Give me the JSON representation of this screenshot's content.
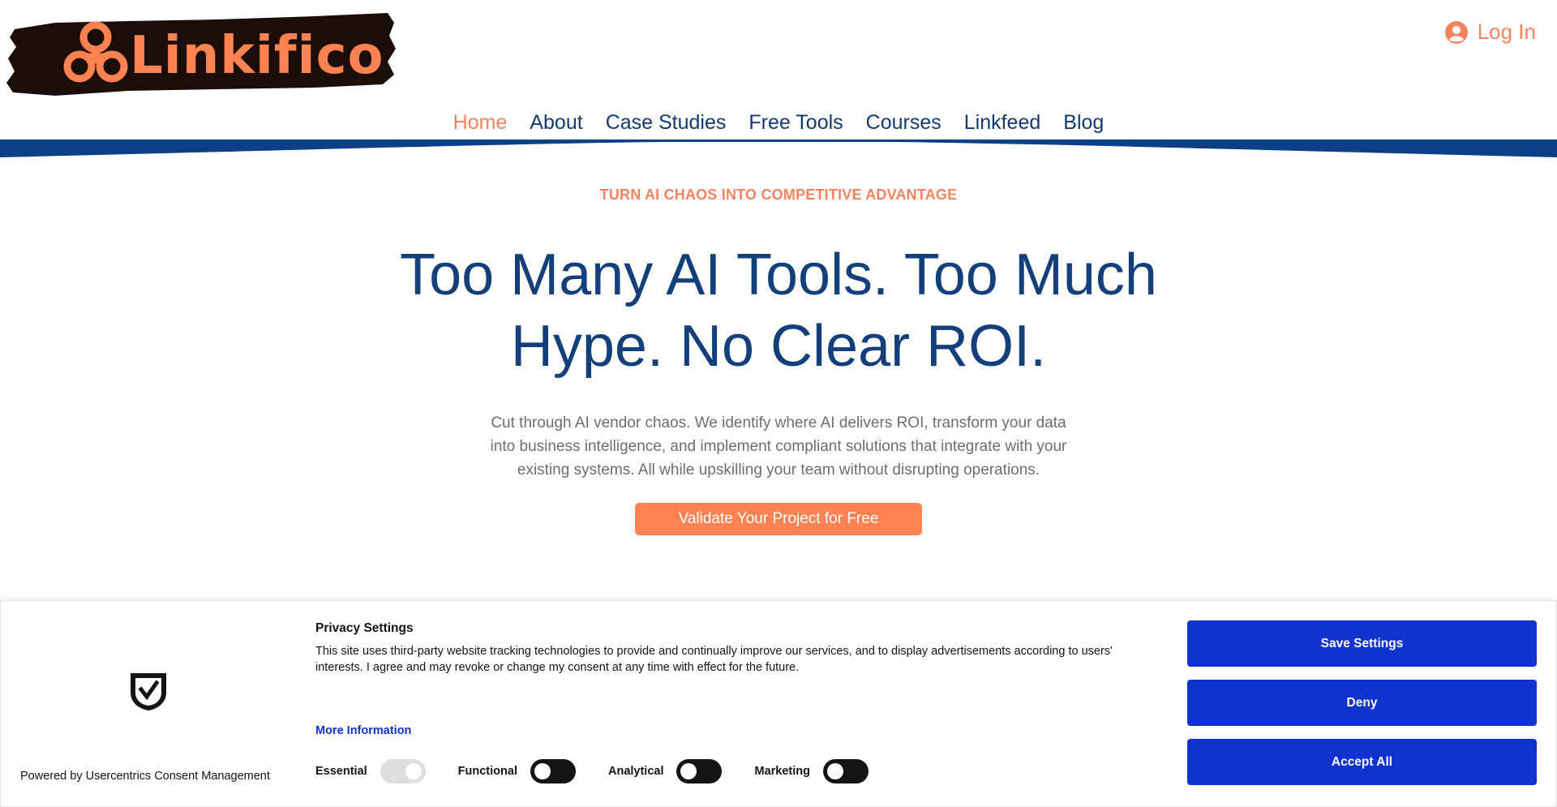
{
  "header": {
    "logo_text": "Linkifico",
    "login_label": "Log In",
    "nav": [
      {
        "label": "Home",
        "active": true
      },
      {
        "label": "About"
      },
      {
        "label": "Case Studies"
      },
      {
        "label": "Free Tools"
      },
      {
        "label": "Courses"
      },
      {
        "label": "Linkfeed"
      },
      {
        "label": "Blog"
      }
    ]
  },
  "hero": {
    "eyebrow": "TURN AI CHAOS INTO COMPETITIVE ADVANTAGE",
    "headline": "Too Many AI Tools. Too Much Hype. No Clear ROI.",
    "subtext": "Cut through AI vendor chaos. We identify where AI delivers ROI, transform your data into business intelligence, and implement compliant solutions that integrate with your existing systems. All while upskilling your team without disrupting operations.",
    "cta_label": "Validate Your Project for Free"
  },
  "consent": {
    "powered_by": "Powered by Usercentrics Consent Management",
    "title": "Privacy Settings",
    "text": "This site uses third-party website tracking technologies to provide and continually improve our services, and to display advertisements according to users' interests. I agree and may revoke or change my consent at any time with effect for the future.",
    "more_info": "More Information",
    "toggles": [
      {
        "label": "Essential",
        "on": true
      },
      {
        "label": "Functional",
        "on": false
      },
      {
        "label": "Analytical",
        "on": false
      },
      {
        "label": "Marketing",
        "on": false
      }
    ],
    "buttons": {
      "save": "Save Settings",
      "deny": "Deny",
      "accept": "Accept All"
    }
  },
  "colors": {
    "accent_orange": "#ff8352",
    "nav_blue": "#133a6f",
    "headline_blue": "#133f7a",
    "consent_blue": "#1032cf"
  },
  "icons": [
    "user-circle-icon",
    "shield-check-icon",
    "logo-knot-icon"
  ]
}
